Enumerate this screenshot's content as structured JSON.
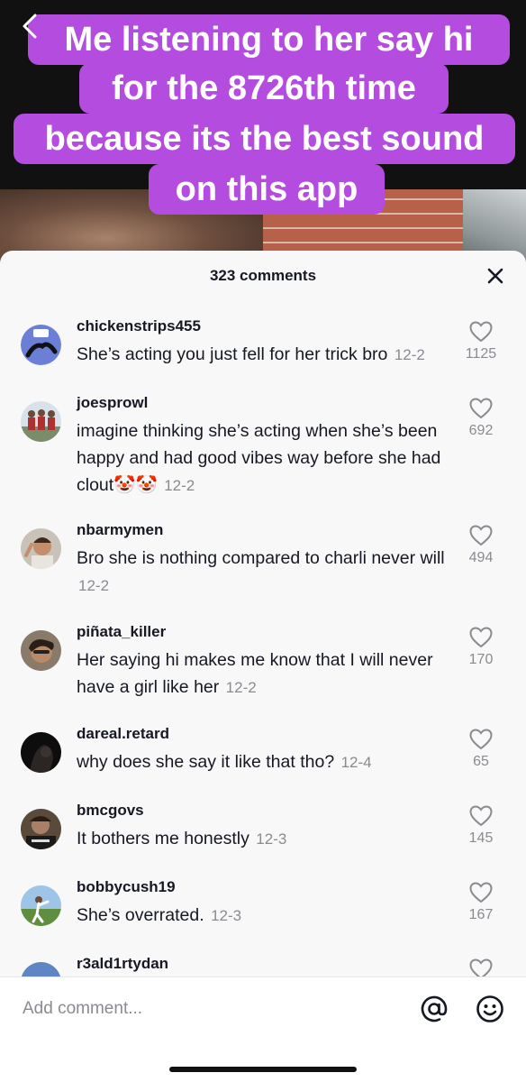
{
  "video": {
    "caption_lines": [
      "Me listening to her say hi",
      "for the 8726th time",
      "because its the best sound",
      "on this app"
    ],
    "caption_color": "#b44ce0"
  },
  "sheet": {
    "comments_count_label": "323 comments"
  },
  "comments": [
    {
      "username": "chickenstrips455",
      "text": "She’s acting you just fell for her trick bro",
      "date": "12-2",
      "likes": "1125",
      "avatar_icon": "avatar-chickenstrips"
    },
    {
      "username": "joesprowl",
      "text": "imagine thinking she’s acting when she’s been happy and had good vibes way before she had clout",
      "emoji": "🤡🤡",
      "date": "12-2",
      "likes": "692",
      "avatar_icon": "avatar-joesprowl"
    },
    {
      "username": "nbarmymen",
      "text": "Bro she is nothing compared to charli never will",
      "date": "12-2",
      "likes": "494",
      "avatar_icon": "avatar-nbarmymen"
    },
    {
      "username": "piñata_killer",
      "text": "Her saying hi makes me know that I will never have a girl like her",
      "date": "12-2",
      "likes": "170",
      "avatar_icon": "avatar-pinata"
    },
    {
      "username": "dareal.retard",
      "text": "why does she say it like that tho?",
      "date": "12-4",
      "likes": "65",
      "avatar_icon": "avatar-dareal"
    },
    {
      "username": "bmcgovs",
      "text": "It bothers me honestly",
      "date": "12-3",
      "likes": "145",
      "avatar_icon": "avatar-bmcgovs"
    },
    {
      "username": "bobbycush19",
      "text": "She’s overrated.",
      "date": "12-3",
      "likes": "167",
      "avatar_icon": "avatar-bobbycush"
    },
    {
      "username": "r3ald1rtydan",
      "text": "",
      "date": "",
      "likes": "",
      "avatar_icon": "avatar-r3ald1rtydan"
    }
  ],
  "composer": {
    "placeholder": "Add comment...",
    "mention_icon": "at-sign-icon",
    "emoji_icon": "smiley-icon"
  },
  "colors": {
    "text_primary": "#161823",
    "text_secondary": "#8a8b91",
    "sheet_bg": "#f8f8f8"
  }
}
